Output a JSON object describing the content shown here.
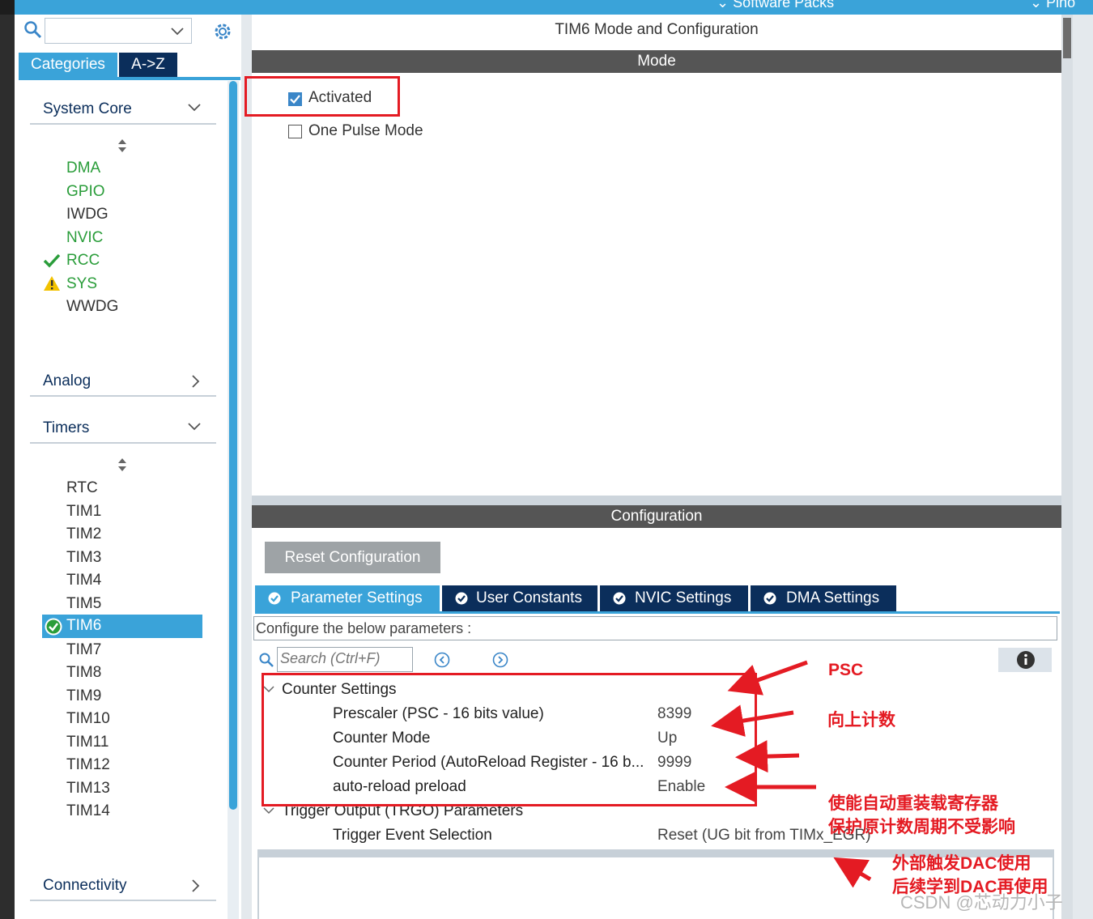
{
  "topbar": {
    "left_text": "Software Packs",
    "right_text": "Pino"
  },
  "left_panel": {
    "search_placeholder": "",
    "tabs": [
      "Categories",
      "A->Z"
    ],
    "groups": {
      "system_core": "System Core",
      "analog": "Analog",
      "timers": "Timers",
      "connectivity": "Connectivity"
    },
    "system_core_items": [
      {
        "label": "DMA",
        "status": "configured"
      },
      {
        "label": "GPIO",
        "status": "configured"
      },
      {
        "label": "IWDG",
        "status": "none"
      },
      {
        "label": "NVIC",
        "status": "configured"
      },
      {
        "label": "RCC",
        "status": "ok"
      },
      {
        "label": "SYS",
        "status": "warning"
      },
      {
        "label": "WWDG",
        "status": "none"
      }
    ],
    "timer_items": [
      "RTC",
      "TIM1",
      "TIM2",
      "TIM3",
      "TIM4",
      "TIM5",
      "TIM6",
      "TIM7",
      "TIM8",
      "TIM9",
      "TIM10",
      "TIM11",
      "TIM12",
      "TIM13",
      "TIM14"
    ],
    "selected_timer": "TIM6"
  },
  "main": {
    "title": "TIM6 Mode and Configuration",
    "mode_header": "Mode",
    "mode_options": [
      {
        "label": "Activated",
        "checked": true
      },
      {
        "label": "One Pulse Mode",
        "checked": false
      }
    ],
    "config_header": "Configuration",
    "reset_button": "Reset Configuration",
    "config_tabs": [
      "Parameter Settings",
      "User Constants",
      "NVIC Settings",
      "DMA Settings"
    ],
    "params_hint": "Configure the below parameters :",
    "search_placeholder": "Search (Ctrl+F)",
    "tree": {
      "counter_settings": {
        "label": "Counter Settings",
        "rows": [
          {
            "name": "Prescaler (PSC - 16 bits value)",
            "value": "8399"
          },
          {
            "name": "Counter Mode",
            "value": "Up"
          },
          {
            "name": "Counter Period (AutoReload Register - 16 b...",
            "value": "9999"
          },
          {
            "name": "auto-reload preload",
            "value": "Enable"
          }
        ]
      },
      "trgo": {
        "label": "Trigger Output (TRGO) Parameters",
        "rows": [
          {
            "name": "Trigger Event Selection",
            "value": "Reset (UG bit from TIMx_EGR)"
          }
        ]
      }
    }
  },
  "annotations": {
    "psc": "PSC",
    "count_up": "向上计数",
    "arr_line1": "使能自动重装载寄存器",
    "arr_line2": "保护原计数周期不受影响",
    "trgo_line1": "外部触发DAC使用",
    "trgo_line2": "后续学到DAC再使用",
    "color": "#e41b23"
  },
  "watermark": "CSDN @芯动力小子"
}
